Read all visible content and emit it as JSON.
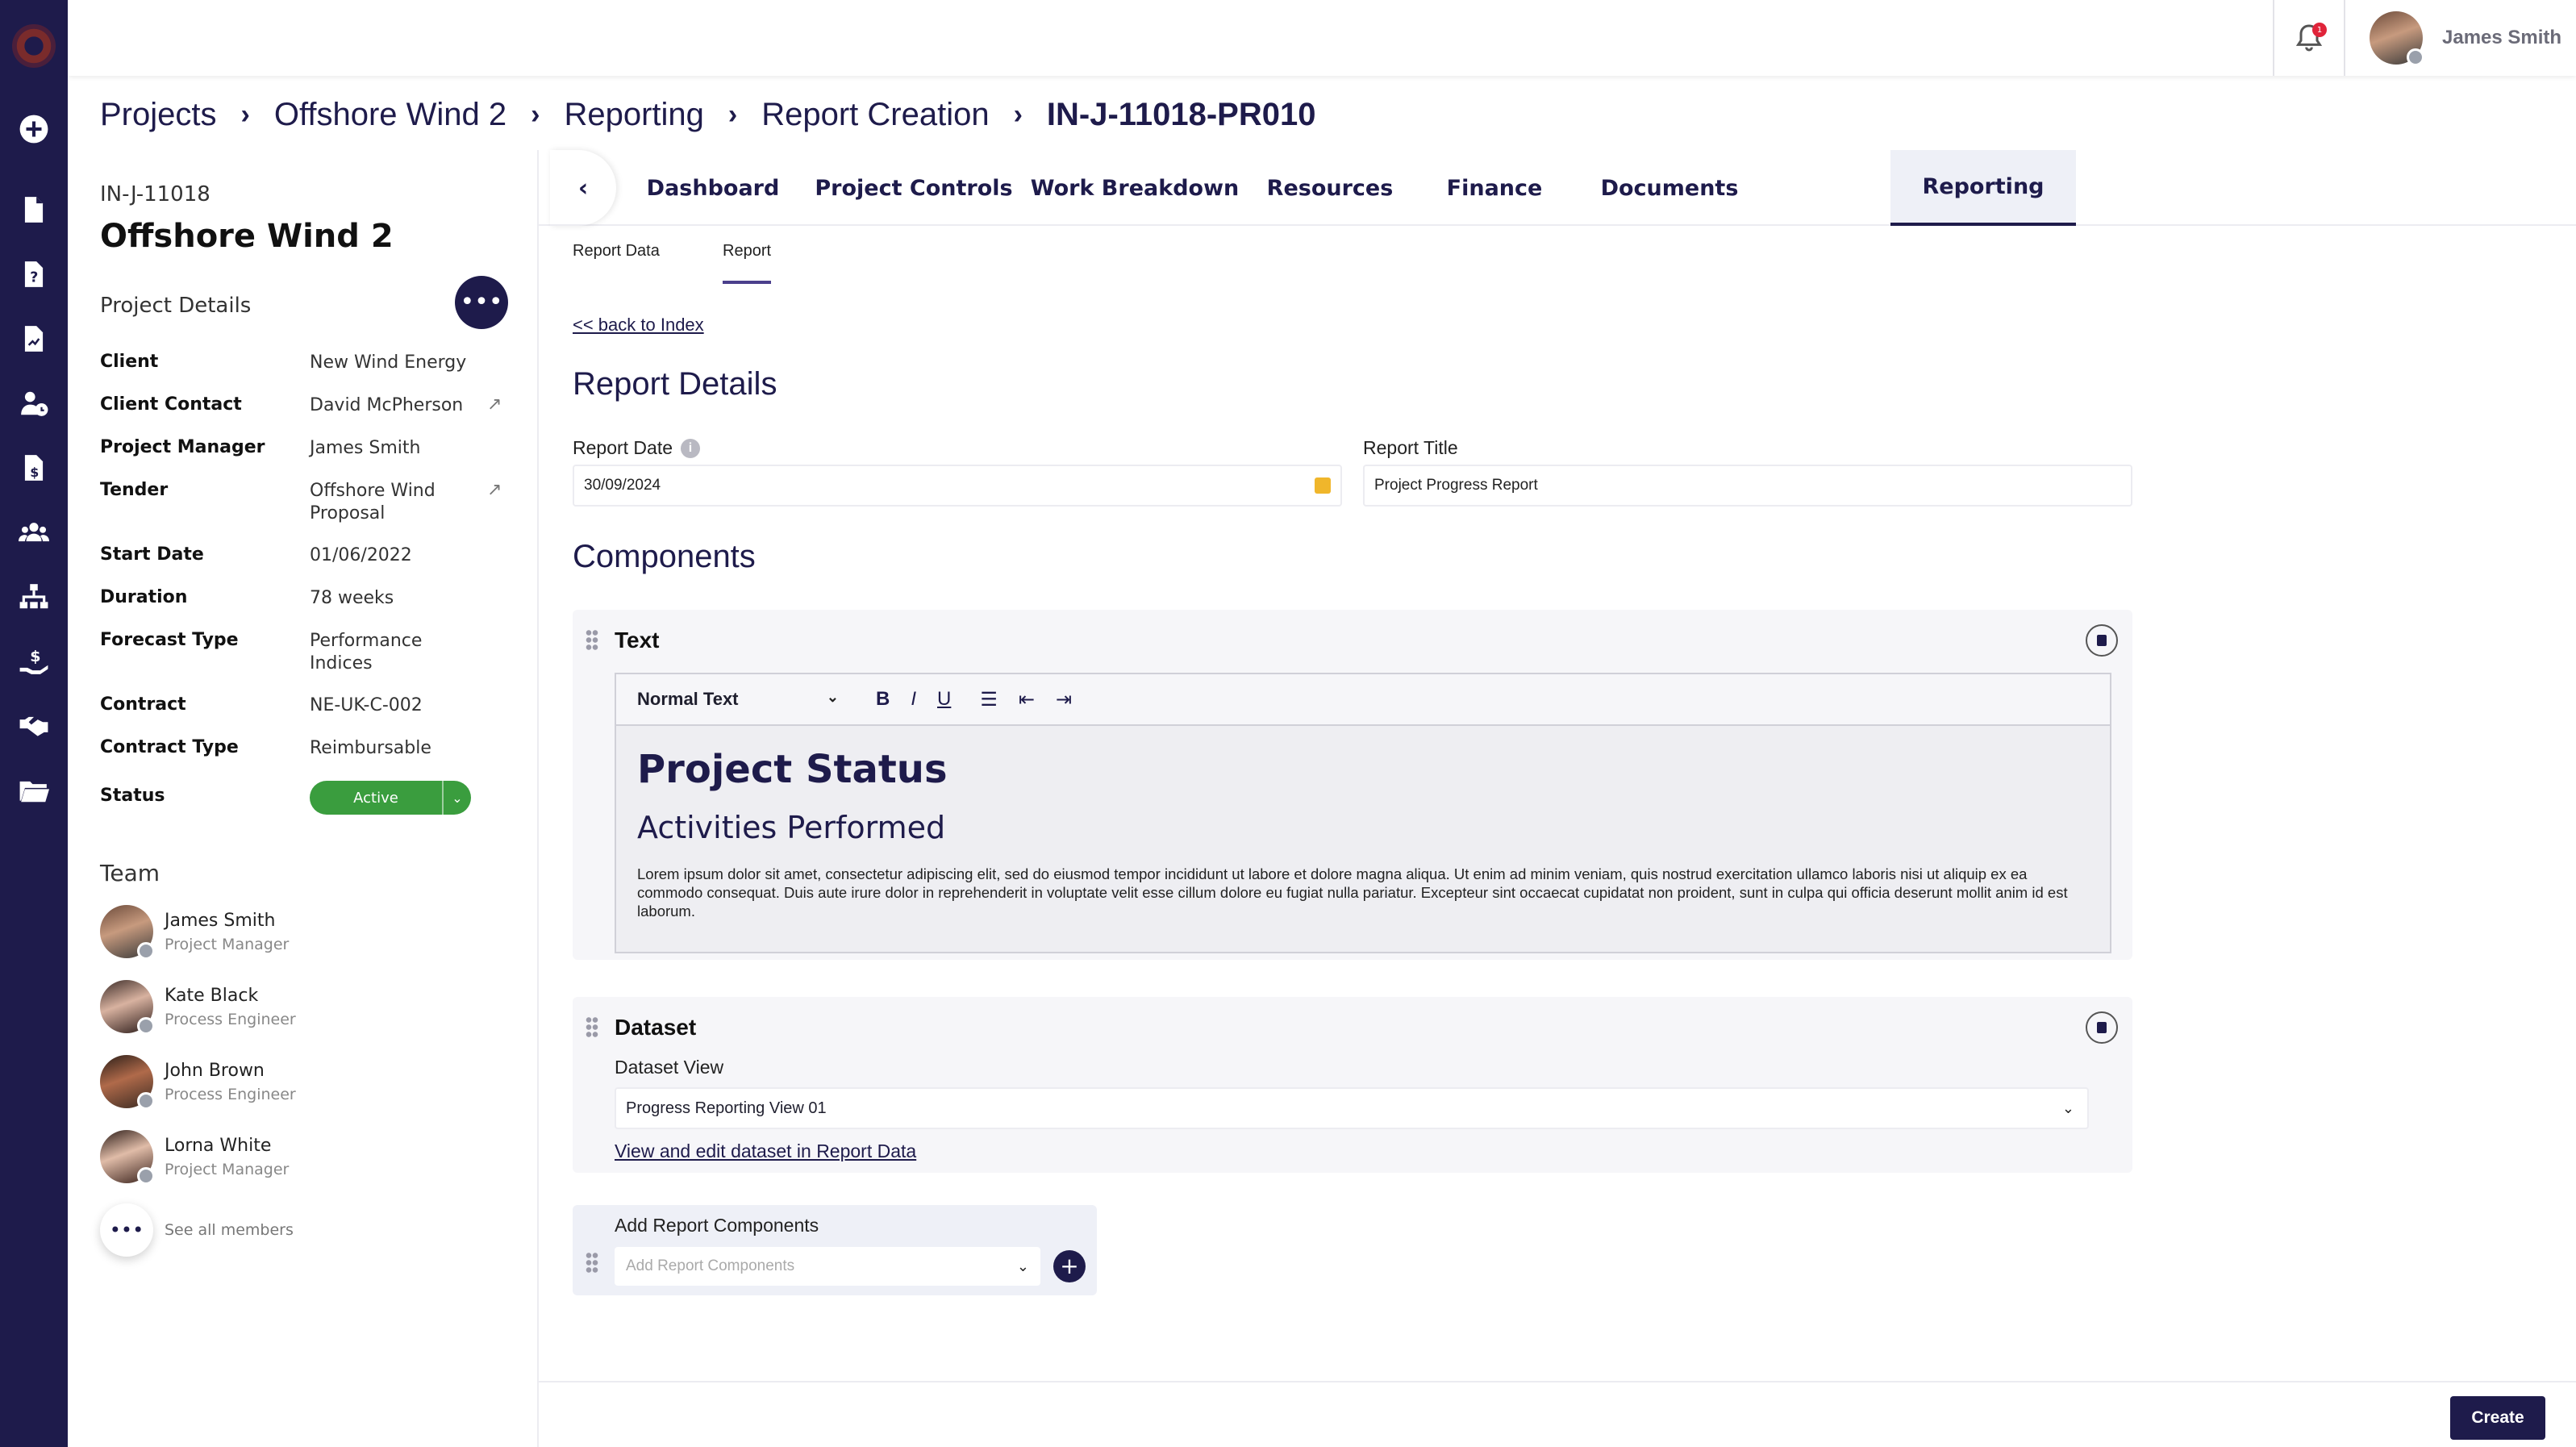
{
  "topbar": {
    "user_name": "James Smith",
    "notification_count": "1"
  },
  "breadcrumb": [
    "Projects",
    "Offshore Wind 2",
    "Reporting",
    "Report Creation",
    "IN-J-11018-PR010"
  ],
  "breadcrumb_separator": "›",
  "project": {
    "id": "IN-J-11018",
    "name": "Offshore Wind 2",
    "details_label": "Project Details",
    "more_label": "•••",
    "fields": [
      {
        "key": "Client",
        "value": "New Wind Energy"
      },
      {
        "key": "Client Contact",
        "value": "David McPherson"
      },
      {
        "key": "Project Manager",
        "value": "James Smith"
      },
      {
        "key": "Tender",
        "value": "Offshore Wind Proposal"
      },
      {
        "key": "Start Date",
        "value": "01/06/2022"
      },
      {
        "key": "Duration",
        "value": "78 weeks"
      },
      {
        "key": "Forecast Type",
        "value": "Performance Indices"
      },
      {
        "key": "Contract",
        "value": "NE-UK-C-002"
      },
      {
        "key": "Contract Type",
        "value": "Reimbursable"
      },
      {
        "key": "Status",
        "value": "Active"
      }
    ],
    "status_color": "#3a9d3e"
  },
  "team": {
    "label": "Team",
    "members": [
      {
        "name": "James Smith",
        "role": "Project Manager"
      },
      {
        "name": "Kate Black",
        "role": "Process Engineer"
      },
      {
        "name": "John Brown",
        "role": "Process Engineer"
      },
      {
        "name": "Lorna White",
        "role": "Project Manager"
      }
    ],
    "see_all": "See all members",
    "see_all_icon": "•••"
  },
  "tabs": [
    "Dashboard",
    "Project Controls",
    "Work Breakdown",
    "Resources",
    "Finance",
    "Documents",
    "Reporting"
  ],
  "active_tab": "Reporting",
  "back_chevron": "‹",
  "subtabs": [
    "Report Data",
    "Report"
  ],
  "active_subtab": "Report",
  "back_link": "<< back to Index",
  "report_details": {
    "heading": "Report Details",
    "date_label": "Report Date",
    "date_value": "30/09/2024",
    "title_label": "Report Title",
    "title_value": "Project Progress Report",
    "info_icon": "i"
  },
  "components": {
    "heading": "Components",
    "text_component": {
      "title": "Text",
      "style_select": "Normal Text",
      "toolbar": {
        "bold": "B",
        "italic": "I",
        "underline": "U",
        "list": "☰",
        "outdent": "⇤",
        "indent": "⇥"
      },
      "h1": "Project Status",
      "h2": "Activities Performed",
      "body": "Lorem ipsum dolor sit amet, consectetur adipiscing elit, sed do eiusmod tempor incididunt ut labore et dolore magna aliqua. Ut enim ad minim veniam, quis nostrud exercitation ullamco laboris nisi ut aliquip ex ea commodo consequat. Duis aute irure dolor in reprehenderit in voluptate velit esse cillum dolore eu fugiat nulla pariatur. Excepteur sint occaecat cupidatat non proident, sunt in culpa qui officia deserunt mollit anim id est laborum."
    },
    "dataset_component": {
      "title": "Dataset",
      "view_label": "Dataset View",
      "view_value": "Progress Reporting View 01",
      "edit_link": "View and edit dataset in Report Data"
    },
    "add": {
      "label": "Add Report Components",
      "placeholder": "Add Report Components",
      "plus": "+"
    }
  },
  "footer": {
    "create_label": "Create"
  },
  "colors": {
    "brand": "#1e1b4b",
    "status_active": "#3a9d3e",
    "notification": "#e0243a"
  },
  "icons": [
    "add-icon",
    "file-icon",
    "question-file-icon",
    "chart-file-icon",
    "user-clock-icon",
    "invoice-icon",
    "team-icon",
    "hierarchy-icon",
    "hand-money-icon",
    "handshake-icon",
    "folder-icon",
    "bell-icon",
    "external-link-icon",
    "calendar-icon",
    "trash-icon",
    "drag-handle-icon"
  ]
}
